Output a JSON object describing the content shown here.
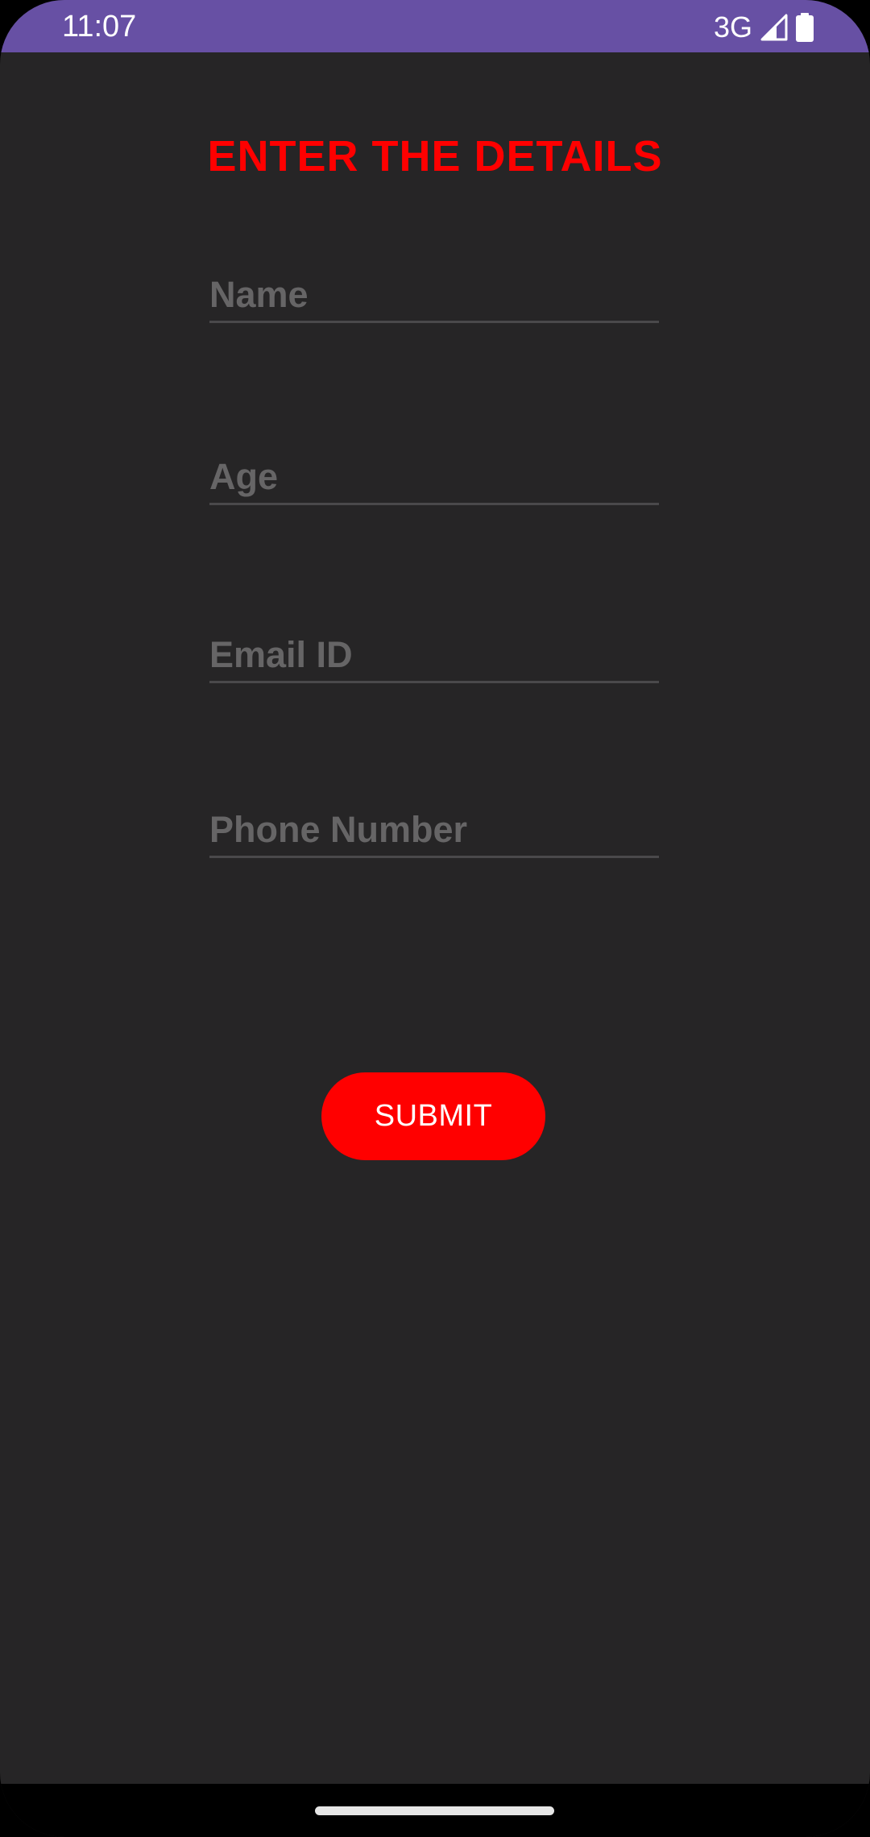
{
  "status_bar": {
    "time": "11:07",
    "network": "3G",
    "background_color": "#6750A4",
    "icons": [
      "signal-icon",
      "battery-icon"
    ]
  },
  "form": {
    "title": "ENTER THE DETAILS",
    "title_color": "#FF0000",
    "fields": [
      {
        "placeholder": "Name",
        "value": ""
      },
      {
        "placeholder": "Age",
        "value": ""
      },
      {
        "placeholder": "Email ID",
        "value": ""
      },
      {
        "placeholder": "Phone Number",
        "value": ""
      }
    ],
    "submit_label": "SUBMIT",
    "submit_color": "#FF0000"
  },
  "theme": {
    "background": "#262526"
  }
}
